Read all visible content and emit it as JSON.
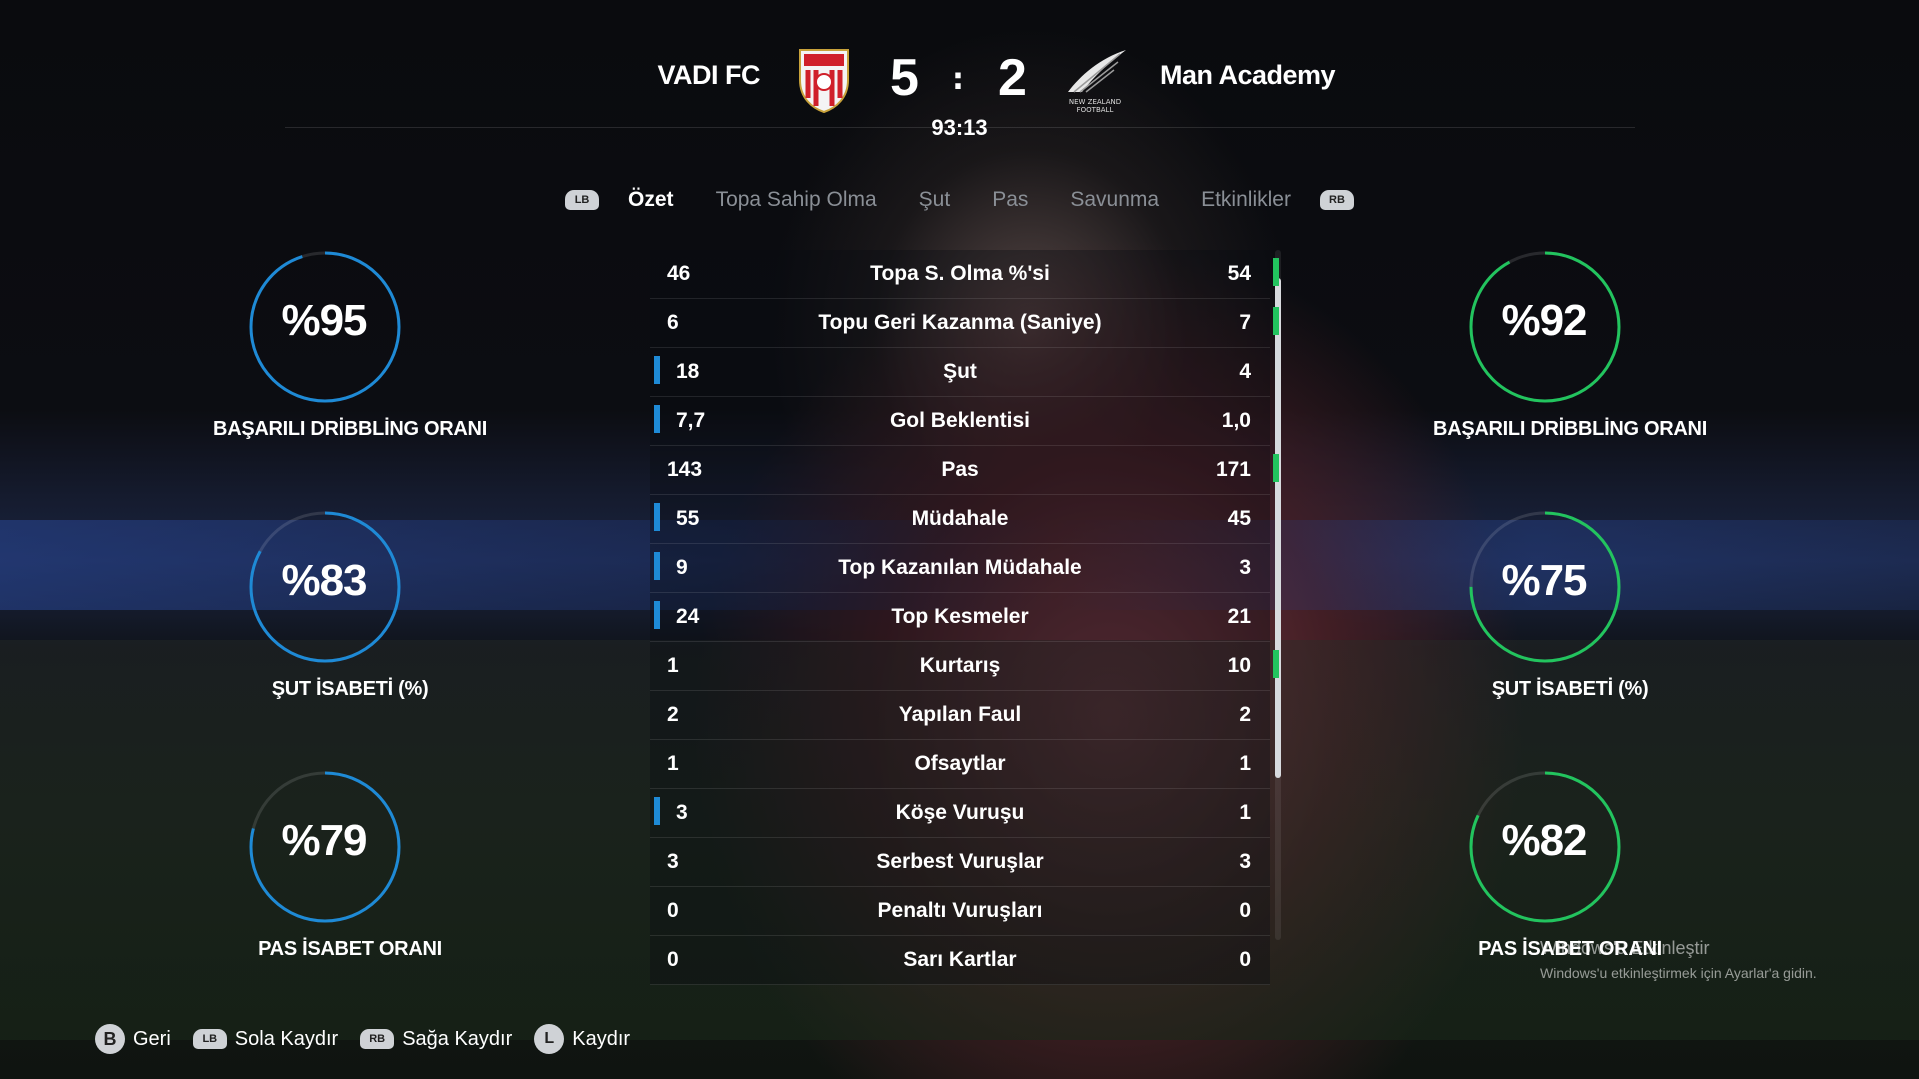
{
  "match": {
    "home_team": "VADI FC",
    "away_team": "Man Academy",
    "home_score": "5",
    "separator": ":",
    "away_score": "2",
    "clock": "93:13",
    "away_crest_text": "NEW ZEALAND FOOTBALL"
  },
  "tabs": {
    "left_bumper": "LB",
    "right_bumper": "RB",
    "items": [
      "Özet",
      "Topa Sahip Olma",
      "Şut",
      "Pas",
      "Savunma",
      "Etkinlikler"
    ],
    "active": "Özet"
  },
  "home_rings": [
    {
      "value": "%95",
      "percent": 95,
      "label": "BAŞARILI DRİBBLİNG ORANI"
    },
    {
      "value": "%83",
      "percent": 83,
      "label": "ŞUT İSABETİ (%)"
    },
    {
      "value": "%79",
      "percent": 79,
      "label": "PAS İSABET ORANI"
    }
  ],
  "away_rings": [
    {
      "value": "%92",
      "percent": 92,
      "label": "BAŞARILI DRİBBLİNG ORANI"
    },
    {
      "value": "%75",
      "percent": 75,
      "label": "ŞUT İSABETİ (%)"
    },
    {
      "value": "%82",
      "percent": 82,
      "label": "PAS İSABET ORANI"
    }
  ],
  "stats": [
    {
      "label": "Topa S. Olma %'si",
      "home": "46",
      "away": "54",
      "leader": "away"
    },
    {
      "label": "Topu Geri Kazanma (Saniye)",
      "home": "6",
      "away": "7",
      "leader": "away"
    },
    {
      "label": "Şut",
      "home": "18",
      "away": "4",
      "leader": "home"
    },
    {
      "label": "Gol Beklentisi",
      "home": "7,7",
      "away": "1,0",
      "leader": "home"
    },
    {
      "label": "Pas",
      "home": "143",
      "away": "171",
      "leader": "away"
    },
    {
      "label": "Müdahale",
      "home": "55",
      "away": "45",
      "leader": "home"
    },
    {
      "label": "Top Kazanılan Müdahale",
      "home": "9",
      "away": "3",
      "leader": "home"
    },
    {
      "label": "Top Kesmeler",
      "home": "24",
      "away": "21",
      "leader": "home"
    },
    {
      "label": "Kurtarış",
      "home": "1",
      "away": "10",
      "leader": "away"
    },
    {
      "label": "Yapılan Faul",
      "home": "2",
      "away": "2",
      "leader": "none"
    },
    {
      "label": "Ofsaytlar",
      "home": "1",
      "away": "1",
      "leader": "none"
    },
    {
      "label": "Köşe Vuruşu",
      "home": "3",
      "away": "1",
      "leader": "home"
    },
    {
      "label": "Serbest Vuruşlar",
      "home": "3",
      "away": "3",
      "leader": "none"
    },
    {
      "label": "Penaltı Vuruşları",
      "home": "0",
      "away": "0",
      "leader": "none"
    },
    {
      "label": "Sarı Kartlar",
      "home": "0",
      "away": "0",
      "leader": "none"
    }
  ],
  "footer": {
    "back_key": "B",
    "back_label": "Geri",
    "left_key": "LB",
    "left_label": "Sola Kaydır",
    "right_key": "RB",
    "right_label": "Sağa Kaydır",
    "scroll_key": "L",
    "scroll_label": "Kaydır"
  },
  "watermark": {
    "line1": "Windows'u Etkinleştir",
    "line2": "Windows'u etkinleştirmek için Ayarlar'a gidin."
  },
  "colors": {
    "home_accent": "#1e8ad6",
    "away_accent": "#22c45e"
  }
}
